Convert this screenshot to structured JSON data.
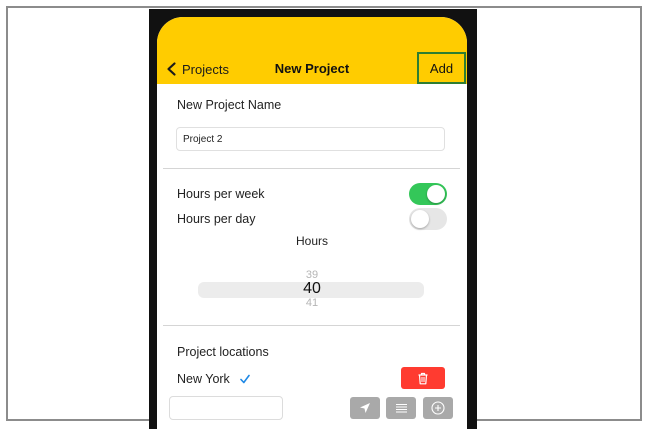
{
  "nav": {
    "back_label": "Projects",
    "title": "New Project",
    "add_label": "Add"
  },
  "project_name": {
    "label": "New Project Name",
    "value": "Project 2"
  },
  "hours": {
    "per_week_label": "Hours per week",
    "per_week_enabled": true,
    "per_day_label": "Hours per day",
    "per_day_enabled": false,
    "picker_title": "Hours",
    "picker_prev": "39",
    "picker_selected": "40",
    "picker_next": "41"
  },
  "locations": {
    "label": "Project locations",
    "items": [
      {
        "name": "New York",
        "checked": true
      }
    ],
    "new_location_value": ""
  },
  "icons": {
    "back": "chevron-left-icon",
    "check": "checkmark-icon",
    "delete": "trash-icon",
    "location": "location-arrow-icon",
    "list": "list-icon",
    "add": "plus-circle-icon"
  },
  "colors": {
    "nav_background": "#ffcc00",
    "toggle_on": "#34c759",
    "toggle_off": "#e6e6e6",
    "delete": "#ff3b30",
    "action_buttons": "#a9a9a9",
    "add_highlight": "#2e7d32",
    "check": "#1e88e5"
  }
}
